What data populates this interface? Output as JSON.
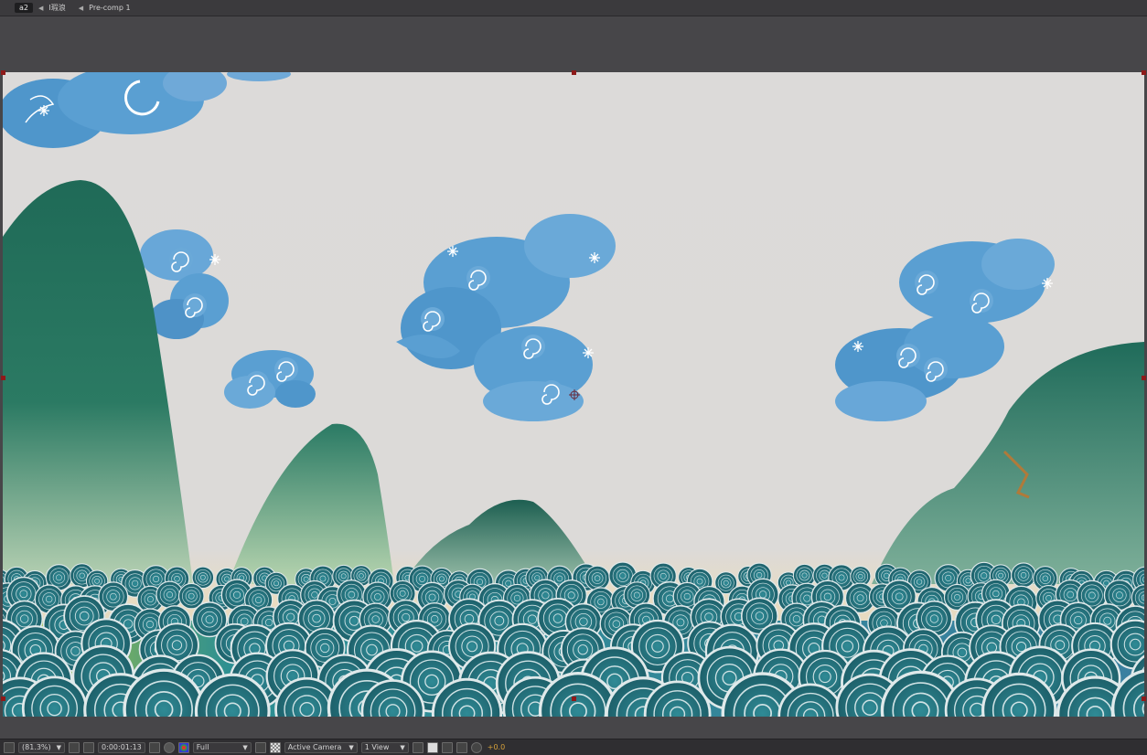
{
  "breadcrumb": {
    "items": [
      {
        "label": "a2",
        "active": true
      },
      {
        "label": "I瑕浪",
        "active": false
      },
      {
        "label": "Pre-comp 1",
        "active": false
      }
    ]
  },
  "viewer": {
    "background": "#474649",
    "comp_background": "#dbd9d8"
  },
  "bottom_bar": {
    "zoom": "(81.3%)",
    "timecode": "0:00:01:13",
    "resolution": "Full",
    "camera": "Active Camera",
    "views": "1 View",
    "exposure": "+0.0"
  },
  "colors": {
    "mountain": "#2b7461",
    "cloud": "#5a9fd2",
    "wave": "#2a7a86",
    "handle": "#8e1a1a"
  }
}
